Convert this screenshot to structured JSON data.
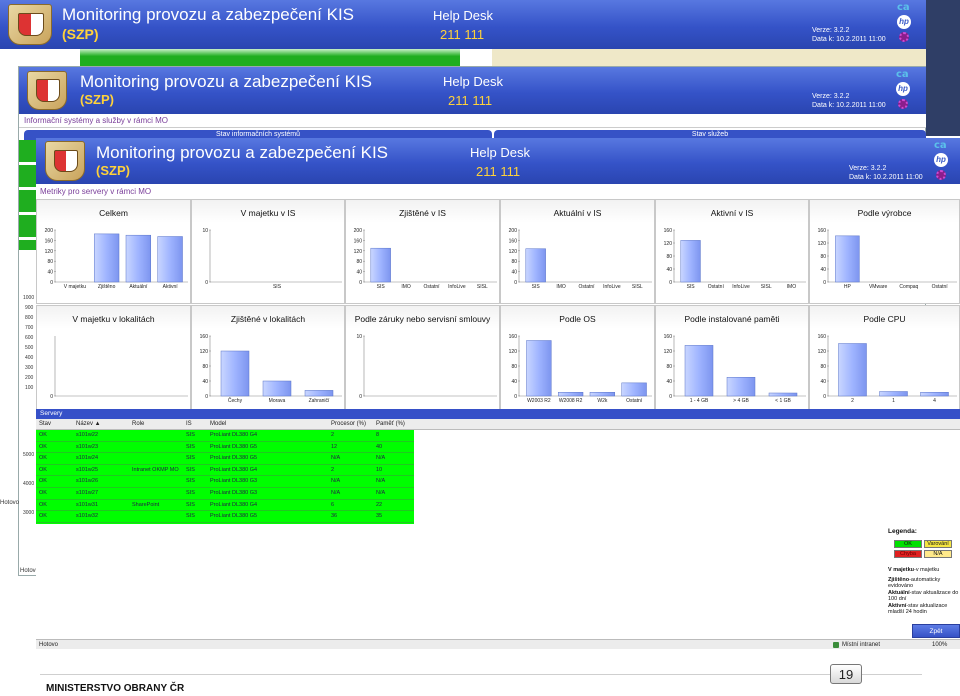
{
  "slide": {
    "footer_org": "MINISTERSTVO OBRANY ČR",
    "page_number": "19"
  },
  "header": {
    "title": "Monitoring provozu a zabezpečení KIS",
    "subtitle": "(SZP)",
    "helpdesk_label": "Help Desk",
    "helpdesk_number": "211 111",
    "version": "Verze:  3.2.2",
    "date": "Data k: 10.2.2011 11:00",
    "logo_ca": "ca",
    "logo_hp": "hp"
  },
  "layer2": {
    "breadcrumb": "Informační systémy a služby v rámci MO",
    "panel_left": "Stav informačních systémů",
    "panel_right": "Stav služeb",
    "y_ticks": [
      "1000",
      "900",
      "800",
      "700",
      "600",
      "500",
      "400",
      "300",
      "200",
      "100"
    ],
    "y_ticks_lower": [
      "5000",
      "4000",
      "3000"
    ],
    "status_text": "Hotovo"
  },
  "layer1": {
    "status_text": "Hotovo"
  },
  "layer3": {
    "breadcrumb": "Metriky pro servery v rámci MO"
  },
  "chart_data": [
    {
      "type": "bar",
      "title": "Celkem",
      "categories": [
        "V majetku",
        "Zjištěno",
        "Aktuální",
        "Aktivní"
      ],
      "values": [
        0,
        185,
        180,
        175
      ],
      "yticks": [
        "200",
        "160",
        "120",
        "80",
        "40",
        "0"
      ],
      "ylim": [
        0,
        200
      ]
    },
    {
      "type": "bar",
      "title": "V majetku v IS",
      "categories": [
        "SIS"
      ],
      "values": [
        0
      ],
      "yticks": [
        "10",
        "0"
      ],
      "ylim": [
        0,
        10
      ]
    },
    {
      "type": "bar",
      "title": "Zjištěné v IS",
      "categories": [
        "SIS",
        "IMO",
        "Ostatní",
        "InfoLive",
        "SISL"
      ],
      "values": [
        130,
        0,
        0,
        0,
        0
      ],
      "yticks": [
        "200",
        "160",
        "120",
        "80",
        "40",
        "0"
      ],
      "ylim": [
        0,
        200
      ]
    },
    {
      "type": "bar",
      "title": "Aktuální v IS",
      "categories": [
        "SIS",
        "IMO",
        "Ostatní",
        "InfoLive",
        "SISL"
      ],
      "values": [
        128,
        0,
        0,
        0,
        0
      ],
      "yticks": [
        "200",
        "160",
        "120",
        "80",
        "40",
        "0"
      ],
      "ylim": [
        0,
        200
      ]
    },
    {
      "type": "bar",
      "title": "Aktivní v IS",
      "categories": [
        "SIS",
        "Ostatní",
        "InfoLive",
        "SISL",
        "IMO"
      ],
      "values": [
        128,
        0,
        0,
        0,
        0
      ],
      "yticks": [
        "160",
        "120",
        "80",
        "40",
        "0"
      ],
      "ylim": [
        0,
        160
      ]
    },
    {
      "type": "bar",
      "title": "Podle výrobce",
      "categories": [
        "HP",
        "VMware",
        "Compaq",
        "Ostatní"
      ],
      "values": [
        142,
        0,
        0,
        0
      ],
      "yticks": [
        "160",
        "120",
        "80",
        "40",
        "0"
      ],
      "ylim": [
        0,
        160
      ]
    },
    {
      "type": "bar",
      "title": "V majetku v lokalitách",
      "categories": [],
      "values": [],
      "yticks": [
        "0"
      ],
      "ylim": [
        0,
        10
      ]
    },
    {
      "type": "bar",
      "title": "Zjištěné v lokalitách",
      "categories": [
        "Čechy",
        "Morava",
        "Zahraničí"
      ],
      "values": [
        120,
        40,
        15
      ],
      "yticks": [
        "160",
        "120",
        "80",
        "40",
        "0"
      ],
      "ylim": [
        0,
        160
      ]
    },
    {
      "type": "bar",
      "title": "Podle záruky nebo servisní smlouvy",
      "categories": [],
      "values": [],
      "yticks": [
        "10",
        "0"
      ],
      "ylim": [
        0,
        10
      ]
    },
    {
      "type": "bar",
      "title": "Podle OS",
      "categories": [
        "W2003 R2",
        "W2008 R2",
        "W2k",
        "Ostatní"
      ],
      "values": [
        148,
        10,
        10,
        35
      ],
      "yticks": [
        "160",
        "120",
        "80",
        "40",
        "0"
      ],
      "ylim": [
        0,
        160
      ]
    },
    {
      "type": "bar",
      "title": "Podle instalované paměti",
      "categories": [
        "1 - 4 GB",
        "> 4 GB",
        "< 1 GB"
      ],
      "values": [
        135,
        50,
        8
      ],
      "yticks": [
        "160",
        "120",
        "80",
        "40",
        "0"
      ],
      "ylim": [
        0,
        160
      ]
    },
    {
      "type": "bar",
      "title": "Podle CPU",
      "categories": [
        "2",
        "1",
        "4"
      ],
      "values": [
        140,
        12,
        10
      ],
      "yticks": [
        "160",
        "120",
        "80",
        "40",
        "0"
      ],
      "ylim": [
        0,
        160
      ]
    }
  ],
  "servers": {
    "title": "Servery",
    "columns": [
      "Stav",
      "Název ▲",
      "Role",
      "IS",
      "Model",
      "Procesor (%)",
      "Paměť (%)"
    ],
    "rows": [
      [
        "OK",
        "s101w22",
        "",
        "SIS",
        "ProLiant DL380 G4",
        "2",
        "8"
      ],
      [
        "OK",
        "s101w23",
        "",
        "SIS",
        "ProLiant DL380 G5",
        "12",
        "40"
      ],
      [
        "OK",
        "s101w24",
        "",
        "SIS",
        "ProLiant DL380 G5",
        "N/A",
        "N/A"
      ],
      [
        "OK",
        "s101w25",
        "Intranet OKMP MO",
        "SIS",
        "ProLiant DL380 G4",
        "2",
        "10"
      ],
      [
        "OK",
        "s101w26",
        "",
        "SIS",
        "ProLiant DL380 G3",
        "N/A",
        "N/A"
      ],
      [
        "OK",
        "s101w27",
        "",
        "SIS",
        "ProLiant DL380 G3",
        "N/A",
        "N/A"
      ],
      [
        "OK",
        "s101w31",
        "SharePoint",
        "SIS",
        "ProLiant DL380 G4",
        "6",
        "22"
      ],
      [
        "OK",
        "s101w32",
        "",
        "SIS",
        "ProLiant DL380 G5",
        "36",
        "35"
      ]
    ]
  },
  "legend": {
    "title": "Legenda:",
    "ok": "OK",
    "warn": "Varování",
    "fail": "Chyba",
    "na": "N/A",
    "line1_b": "V majetku",
    "line1": "-v majetku",
    "line2_b": "Zjištěno",
    "line2": "-automaticky evidováno",
    "line3_b": "Aktuální",
    "line3": "-stav aktualizace do 100 dní",
    "line4_b": "Aktivní",
    "line4": "-stav aktualizace mladší 24 hodin",
    "colors": {
      "ok": "#00e000",
      "warn": "#f5e642",
      "fail": "#e02020",
      "na": "#ffe98a"
    }
  },
  "bottom": {
    "status_text": "Hotovo",
    "zone": "Místní intranet",
    "zoom": "100%",
    "back_button": "Zpět"
  }
}
